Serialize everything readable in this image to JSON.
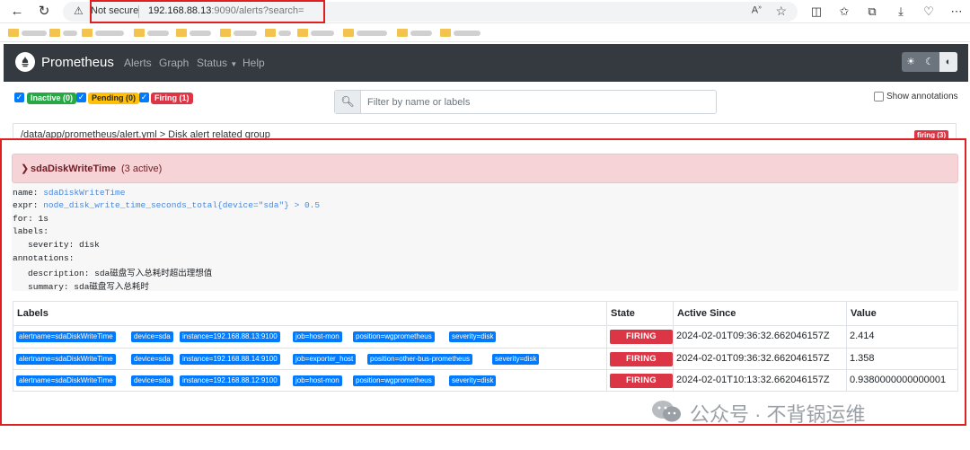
{
  "browser": {
    "warning_label": "Not secure",
    "url_host": "192.168.88.13",
    "url_rest": ":9090/alerts?search="
  },
  "app": {
    "brand": "Prometheus",
    "nav": [
      "Alerts",
      "Graph",
      "Status",
      "Help"
    ]
  },
  "filters": {
    "inactive": "Inactive (0)",
    "pending": "Pending (0)",
    "firing": "Firing (1)",
    "search_placeholder": "Filter by name or labels",
    "show_annotations": "Show annotations"
  },
  "group": {
    "path": "/data/app/prometheus/alert.yml > Disk alert related group",
    "badge": "firing (3)"
  },
  "rule": {
    "name": "sdaDiskWriteTime",
    "count": "(3 active)",
    "lines": {
      "name_key": "name:",
      "name_val": "sdaDiskWriteTime",
      "expr_key": "expr:",
      "expr_val": "node_disk_write_time_seconds_total{device=\"sda\"} > 0.5",
      "for": "for: 1s",
      "labels": "labels:",
      "severity": "severity: disk",
      "annotations": "annotations:",
      "description": "description: sda磁盘写入总耗时超出理想值",
      "summary": "summary: sda磁盘写入总耗时"
    }
  },
  "table": {
    "headers": [
      "Labels",
      "State",
      "Active Since",
      "Value"
    ],
    "rows": [
      {
        "labels": [
          "alertname=sdaDiskWriteTime",
          "device=sda",
          "instance=192.168.88.13:9100",
          "job=host-mon",
          "position=wgprometheus",
          "severity=disk"
        ],
        "state": "FIRING",
        "since": "2024-02-01T09:36:32.662046157Z",
        "value": "2.414"
      },
      {
        "labels": [
          "alertname=sdaDiskWriteTime",
          "device=sda",
          "instance=192.168.88.14:9100",
          "job=exporter_host",
          "position=other-bus-prometheus",
          "severity=disk"
        ],
        "state": "FIRING",
        "since": "2024-02-01T09:36:32.662046157Z",
        "value": "1.358"
      },
      {
        "labels": [
          "alertname=sdaDiskWriteTime",
          "device=sda",
          "instance=192.168.88.12:9100",
          "job=host-mon",
          "position=wgprometheus",
          "severity=disk"
        ],
        "state": "FIRING",
        "since": "2024-02-01T10:13:32.662046157Z",
        "value": "0.9380000000000001"
      }
    ]
  },
  "watermark": "公众号 · 不背锅运维",
  "colors": {
    "navbar": "#343a40",
    "firing": "#dc3545",
    "label_badge": "#007bff",
    "highlight": "#e02020"
  }
}
